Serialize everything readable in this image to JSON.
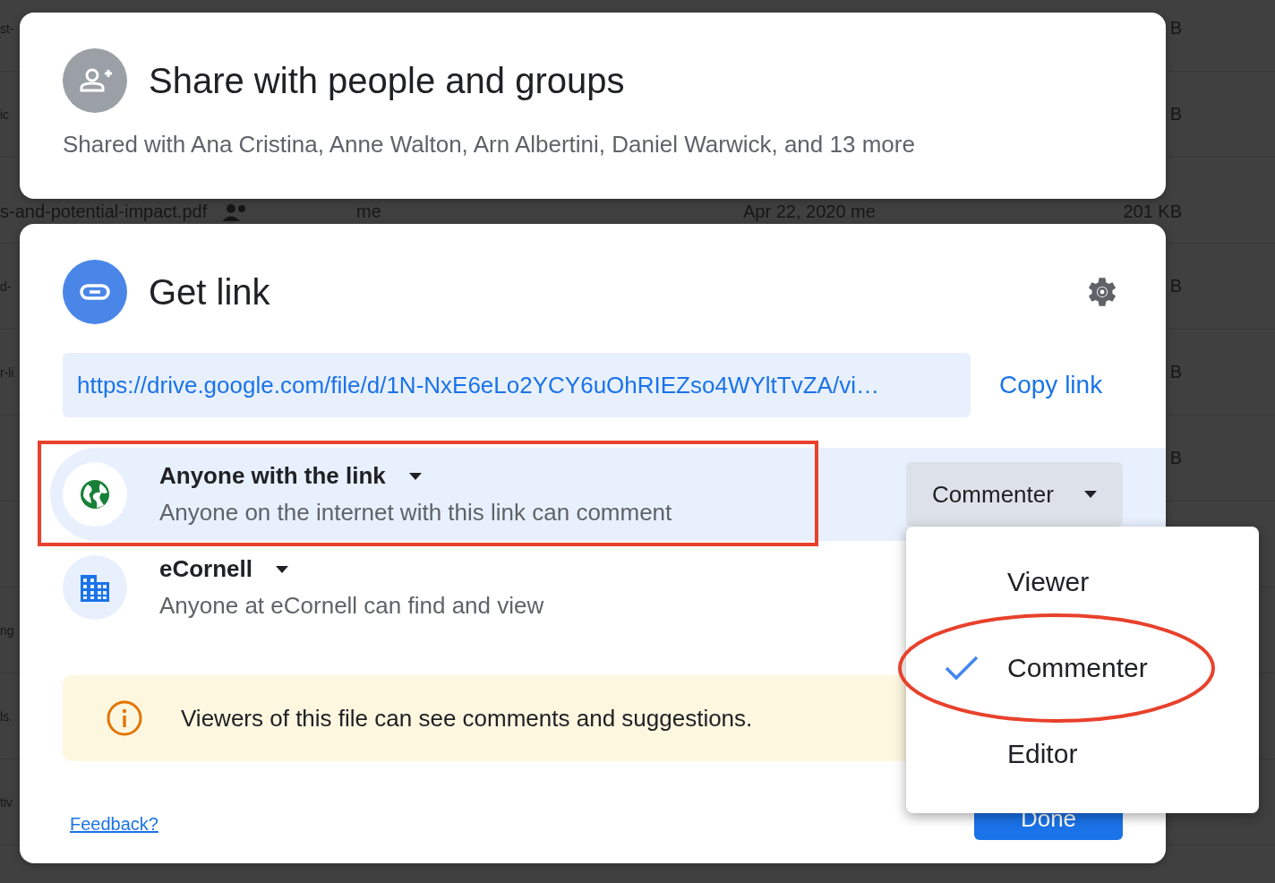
{
  "background_list": {
    "rows": [
      {
        "name": "st-",
        "size": "B"
      },
      {
        "name": "ic",
        "size": "B"
      },
      {
        "name": "s-and-potential-impact.pdf",
        "shared": true,
        "owner": "me",
        "modified": "Apr 22, 2020 me",
        "size": "201 KB"
      },
      {
        "name": "d-",
        "size": "B"
      },
      {
        "name": "r-li",
        "size": "B"
      },
      {
        "size": "B"
      },
      {},
      {
        "name": "ng"
      },
      {
        "name": "ls."
      },
      {
        "name": "tiv"
      }
    ]
  },
  "share_panel": {
    "title": "Share with people and groups",
    "subtitle": "Shared with Ana Cristina, Anne Walton, Arn Albertini, Daniel Warwick, and 13 more"
  },
  "link_panel": {
    "title": "Get link",
    "url": "https://drive.google.com/file/d/1N-NxE6eLo2YCY6uOhRIEZso4WYltTvZA/vi…",
    "copy_button": "Copy link",
    "access": [
      {
        "kind": "public",
        "title": "Anyone with the link",
        "description": "Anyone on the internet with this link can comment",
        "selected": true,
        "role": "Commenter",
        "highlighted": true
      },
      {
        "kind": "domain",
        "title": "eCornell",
        "description": "Anyone at eCornell can find and view",
        "selected": false,
        "highlighted": false
      }
    ],
    "notice": "Viewers of this file can see comments and suggestions.",
    "feedback_link": "Feedback?",
    "done_button": "Done"
  },
  "role_menu": {
    "items": [
      {
        "label": "Viewer",
        "selected": false,
        "highlighted": false
      },
      {
        "label": "Commenter",
        "selected": true,
        "highlighted": true
      },
      {
        "label": "Editor",
        "selected": false,
        "highlighted": false
      }
    ]
  }
}
